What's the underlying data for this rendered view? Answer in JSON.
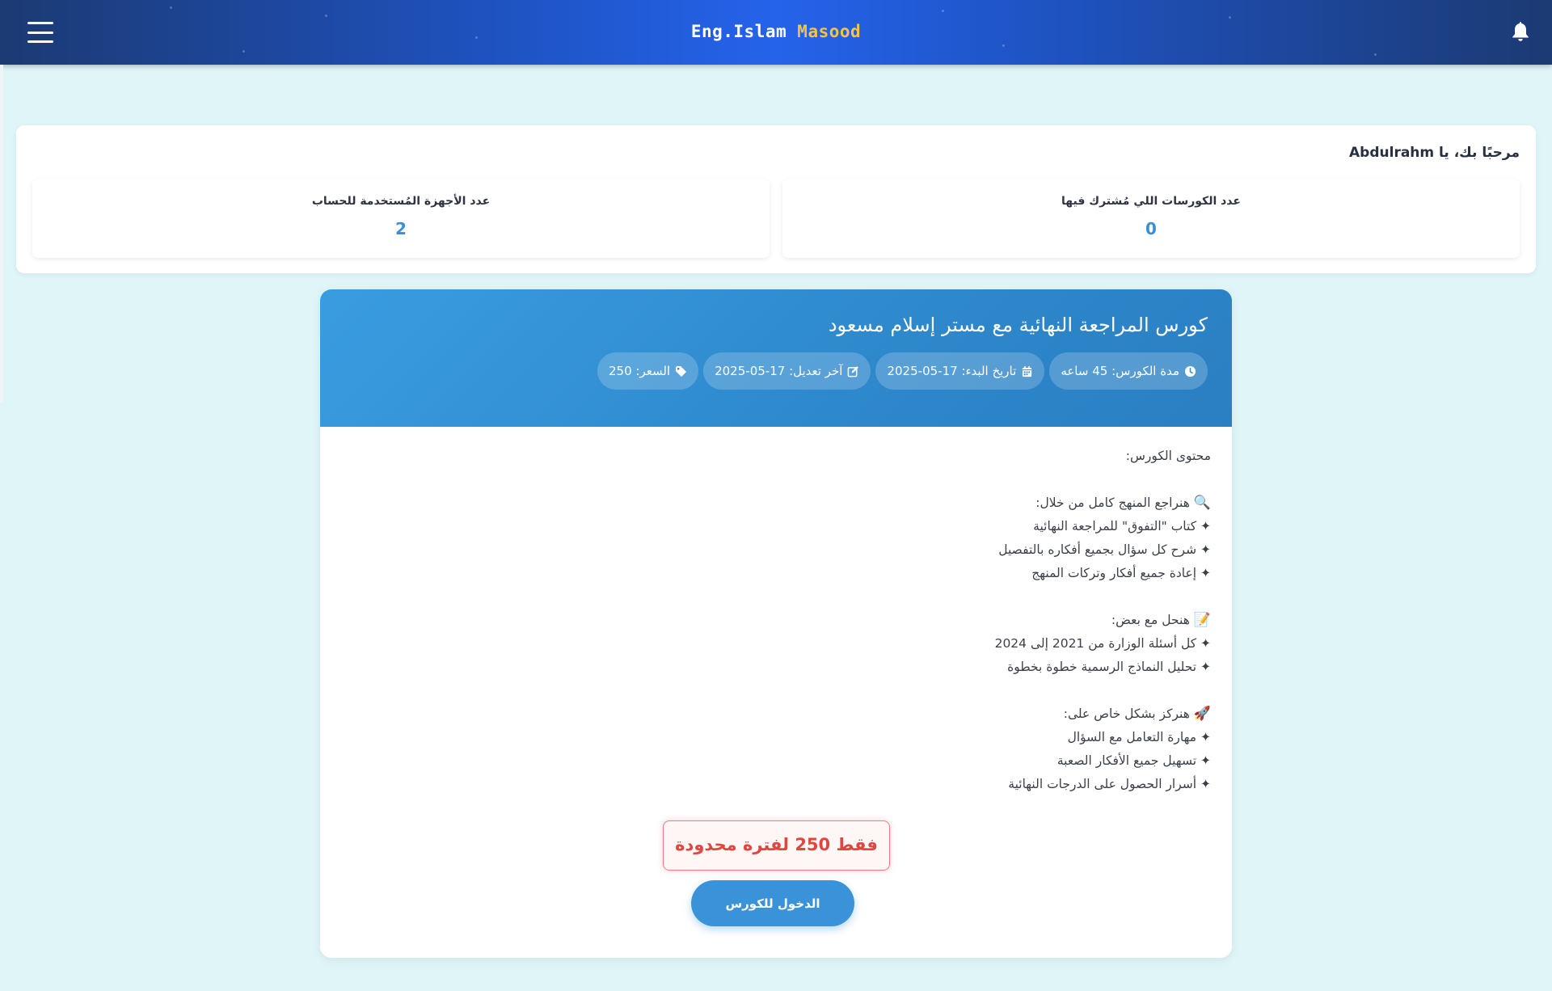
{
  "header": {
    "brand_first": "Eng.Islam",
    "brand_second": "Masood",
    "menu_icon": "hamburger-menu-icon",
    "notification_icon": "bell-icon"
  },
  "welcome": {
    "text": "مرحبًا بك، يا Abdulrahm"
  },
  "stats": {
    "courses_label": "عدد الكورسات اللي مُشترك فيها",
    "courses_value": "0",
    "devices_label": "عدد الأجهزة المُستخدمة للحساب",
    "devices_value": "2"
  },
  "course": {
    "title": "كورس المراجعة النهائية مع مستر إسلام مسعود",
    "chips": {
      "duration": "مدة الكورس: 45 ساعه",
      "start_date": "تاريخ البدء: 17-05-2025",
      "modified": "آخر تعديل: 17-05-2025",
      "price": "السعر: 250"
    },
    "content": {
      "heading": "محتوى الكورس:",
      "section1_title": "هنراجع المنهج كامل من خلال:",
      "section1_items": [
        "✦ كتاب \"التفوق\" للمراجعة النهائية",
        "✦ شرح كل سؤال بجميع أفكاره بالتفصيل",
        "✦ إعادة جميع أفكار وتركات المنهج"
      ],
      "section2_title": "هنحل مع بعض:",
      "section2_items": [
        "✦ كل أسئلة الوزارة من 2021 إلى 2024",
        "✦ تحليل النماذج الرسمية خطوة بخطوة"
      ],
      "section3_title": "هنركز بشكل خاص على:",
      "section3_items": [
        "✦ مهارة التعامل مع السؤال",
        "✦ تسهيل جميع الأفكار الصعبة",
        "✦ أسرار الحصول على الدرجات النهائية"
      ]
    },
    "promo": "فقط 250 لفترة محدودة",
    "enter_button": "الدخول للكورس"
  },
  "colors": {
    "accent": "#3a93d8",
    "brand_highlight": "#f5c542",
    "promo_red": "#e0453f",
    "page_bg": "#dff5f8"
  }
}
